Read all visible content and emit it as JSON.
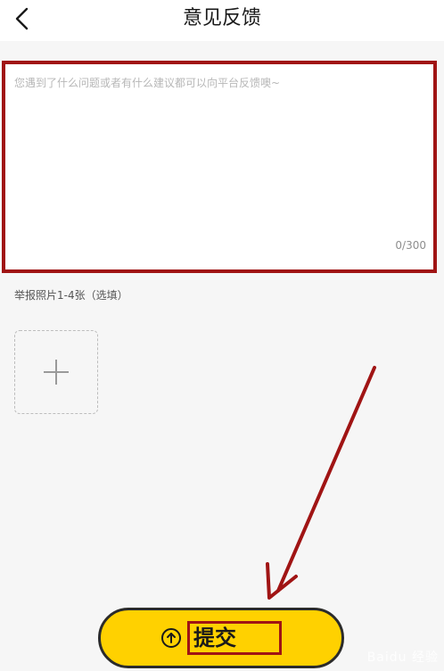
{
  "header": {
    "title": "意见反馈"
  },
  "feedback": {
    "placeholder": "您遇到了什么问题或者有什么建议都可以向平台反馈噢~",
    "counter": "0/300"
  },
  "photos": {
    "label": "举报照片1-4张（选填）"
  },
  "submit": {
    "label": "提交"
  },
  "watermark": {
    "text": "Baidu 经验"
  },
  "colors": {
    "accent": "#ffd100",
    "annotation": "#a01414"
  }
}
